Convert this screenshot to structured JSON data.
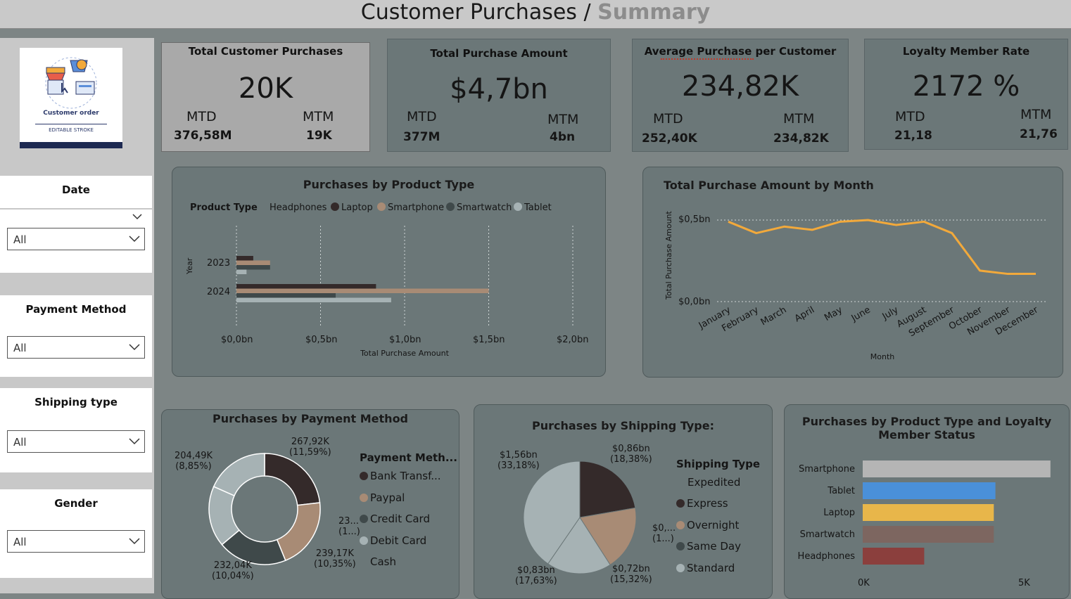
{
  "header": {
    "title": "Customer Purchases",
    "separator": " / ",
    "subtitle": "Summary"
  },
  "logo": {
    "caption": "Customer order",
    "subcaption": "EDITABLE STROKE"
  },
  "slicers": [
    {
      "label": "Date",
      "value": "All"
    },
    {
      "label": "Payment Method",
      "value": "All"
    },
    {
      "label": "Shipping type",
      "value": "All"
    },
    {
      "label": "Gender",
      "value": "All"
    }
  ],
  "kpis": [
    {
      "title": "Total Customer Purchases",
      "value": "20K",
      "mtd_label": "MTD",
      "mtd": "376,58M",
      "mtm_label": "MTM",
      "mtm": "19K"
    },
    {
      "title": "Total Purchase Amount",
      "value": "$4,7bn",
      "mtd_label": "MTD",
      "mtd": "377M",
      "mtm_label": "MTM",
      "mtm": "4bn"
    },
    {
      "title": "Average Purchase per Customer",
      "value": "234,82K",
      "mtd_label": "MTD",
      "mtd": "252,40K",
      "mtm_label": "MTM",
      "mtm": "234,82K"
    },
    {
      "title": "Loyalty Member Rate",
      "value": "2172 %",
      "mtd_label": "MTD",
      "mtd": "21,18",
      "mtm_label": "MTM",
      "mtm": "21,76"
    }
  ],
  "colors": {
    "dark": "#342a2a",
    "tan": "#a88b75",
    "slate": "#3f494a",
    "light": "#a6b2b4",
    "orange": "#f2a93b",
    "gray": "#b5b5b5",
    "blue": "#4a90d9",
    "gold": "#e8b64a",
    "brown": "#7d6660",
    "red": "#8b3f3d"
  },
  "chart_data": [
    {
      "type": "bar",
      "title": "Purchases by Product Type",
      "legend_title": "Product Type",
      "legend": [
        "Headphones",
        "Laptop",
        "Smartphone",
        "Smartwatch",
        "Tablet"
      ],
      "ylabel": "Year",
      "xlabel": "Total Purchase Amount",
      "categories": [
        "2023",
        "2024"
      ],
      "xticks": [
        "$0,0bn",
        "$0,5bn",
        "$1,0bn",
        "$1,5bn",
        "$2,0bn"
      ],
      "xlim": [
        0,
        2.0
      ],
      "series": [
        {
          "name": "Laptop",
          "values": [
            0.1,
            0.83
          ]
        },
        {
          "name": "Smartphone",
          "values": [
            0.2,
            1.5
          ]
        },
        {
          "name": "Smartwatch",
          "values": [
            0.2,
            0.59
          ]
        },
        {
          "name": "Tablet",
          "values": [
            0.06,
            0.92
          ]
        }
      ]
    },
    {
      "type": "line",
      "title": "Total Purchase Amount by Month",
      "xlabel": "Month",
      "ylabel": "Total Purchase Amount",
      "yticks": [
        "$0,0bn",
        "$0,5bn"
      ],
      "ylim": [
        0,
        0.5
      ],
      "x": [
        "January",
        "February",
        "March",
        "April",
        "May",
        "June",
        "July",
        "August",
        "September",
        "October",
        "November",
        "December"
      ],
      "values": [
        0.49,
        0.42,
        0.46,
        0.44,
        0.49,
        0.5,
        0.47,
        0.49,
        0.42,
        0.19,
        0.17,
        0.17
      ]
    },
    {
      "type": "pie",
      "title": "Purchases by Payment Method",
      "legend_title": "Payment Meth...",
      "categories": [
        "Bank Transf...",
        "Paypal",
        "Credit Card",
        "Debit Card",
        "Cash"
      ],
      "values": [
        267.92,
        239.17,
        232.04,
        204.49,
        212.6
      ],
      "labels": [
        {
          "value": "267,92K",
          "pct": "(11,59%)"
        },
        {
          "value": "23...",
          "pct": "(1...)"
        },
        {
          "value": "239,17K",
          "pct": "(10,35%)"
        },
        {
          "value": "232,04K",
          "pct": "(10,04%)"
        },
        {
          "value": "204,49K",
          "pct": "(8,85%)"
        }
      ]
    },
    {
      "type": "pie",
      "title": "Purchases by Shipping Type:",
      "legend_title": "Shipping Type",
      "categories": [
        "Expedited",
        "Express",
        "Overnight",
        "Same Day",
        "Standard"
      ],
      "values": [
        1.56,
        0.86,
        0.72,
        0.83,
        0.72
      ],
      "labels": [
        {
          "value": "$1,56bn",
          "pct": "(33,18%)"
        },
        {
          "value": "$0,86bn",
          "pct": "(18,38%)"
        },
        {
          "value": "$0,...",
          "pct": "(1...)"
        },
        {
          "value": "$0,72bn",
          "pct": "(15,32%)"
        },
        {
          "value": "$0,83bn",
          "pct": "(17,63%)"
        }
      ]
    },
    {
      "type": "bar",
      "title": "Purchases by Product Type and Loyalty Member Status",
      "categories": [
        "Smartphone",
        "Tablet",
        "Laptop",
        "Smartwatch",
        "Headphones"
      ],
      "values": [
        5.8,
        4.1,
        4.05,
        4.05,
        1.9
      ],
      "xticks": [
        "0K",
        "5K"
      ],
      "xlim": [
        0,
        5
      ]
    }
  ]
}
